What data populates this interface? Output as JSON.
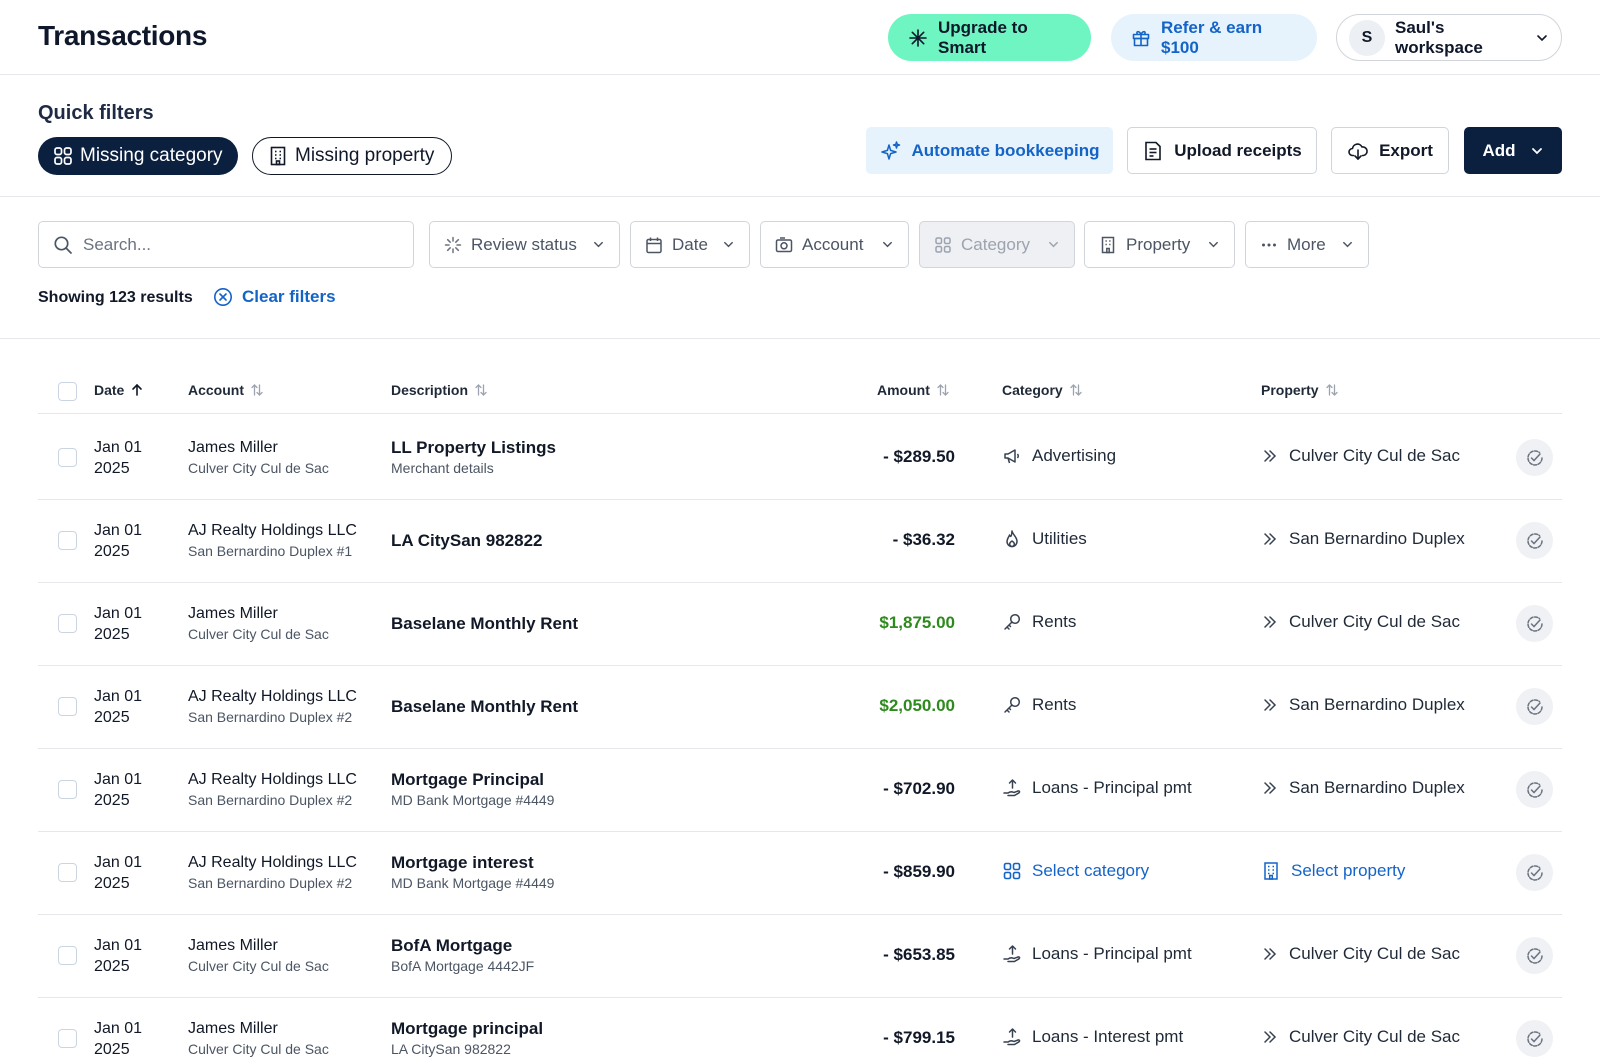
{
  "header": {
    "title": "Transactions",
    "upgrade_label": "Upgrade to Smart",
    "refer_label": "Refer & earn $100",
    "workspace": {
      "avatar_initial": "S",
      "label": "Saul's workspace"
    }
  },
  "quick_filters": {
    "title": "Quick filters",
    "chips": [
      "Missing category",
      "Missing property"
    ],
    "actions": {
      "automate": "Automate bookkeeping",
      "upload": "Upload receipts",
      "export": "Export",
      "add": "Add"
    }
  },
  "filters": {
    "search_placeholder": "Search...",
    "dropdowns": [
      "Review status",
      "Date",
      "Account",
      "Category",
      "Property",
      "More"
    ],
    "results_text": "Showing 123 results",
    "clear_label": "Clear filters"
  },
  "table": {
    "columns": [
      "Date",
      "Account",
      "Description",
      "Amount",
      "Category",
      "Property"
    ],
    "rows": [
      {
        "date": "Jan 01",
        "year": "2025",
        "account": "James Miller",
        "account_sub": "Culver City Cul de Sac",
        "description": "LL Property Listings",
        "description_sub": "Merchant details",
        "amount": "- $289.50",
        "category": "Advertising",
        "category_icon": "megaphone-icon",
        "property": "Culver City Cul de Sac"
      },
      {
        "date": "Jan 01",
        "year": "2025",
        "account": "AJ Realty Holdings LLC",
        "account_sub": "San Bernardino Duplex #1",
        "description": "LA CitySan 982822",
        "description_sub": "",
        "amount": "- $36.32",
        "category": "Utilities",
        "category_icon": "flame-icon",
        "property": "San Bernardino Duplex"
      },
      {
        "date": "Jan 01",
        "year": "2025",
        "account": "James Miller",
        "account_sub": "Culver City Cul de Sac",
        "description": "Baselane Monthly Rent",
        "description_sub": "",
        "amount": "$1,875.00",
        "category": "Rents",
        "category_icon": "key-icon",
        "property": "Culver City Cul de Sac"
      },
      {
        "date": "Jan 01",
        "year": "2025",
        "account": "AJ Realty Holdings LLC",
        "account_sub": "San Bernardino Duplex #2",
        "description": "Baselane Monthly Rent",
        "description_sub": "",
        "amount": "$2,050.00",
        "category": "Rents",
        "category_icon": "key-icon",
        "property": "San Bernardino Duplex"
      },
      {
        "date": "Jan 01",
        "year": "2025",
        "account": "AJ Realty Holdings LLC",
        "account_sub": "San Bernardino Duplex #2",
        "description": "Mortgage Principal",
        "description_sub": "MD Bank Mortgage #4449",
        "amount": "- $702.90",
        "category": "Loans - Principal pmt",
        "category_icon": "loan-icon",
        "property": "San Bernardino Duplex"
      },
      {
        "date": "Jan 01",
        "year": "2025",
        "account": "AJ Realty Holdings LLC",
        "account_sub": "San Bernardino Duplex #2",
        "description": "Mortgage interest",
        "description_sub": "MD Bank Mortgage #4449",
        "amount": "- $859.90",
        "category": "Select category",
        "category_icon": "grid-icon",
        "property": "Select property"
      },
      {
        "date": "Jan 01",
        "year": "2025",
        "account": "James Miller",
        "account_sub": "Culver City Cul de Sac",
        "description": "BofA Mortgage",
        "description_sub": "BofA Mortgage 4442JF",
        "amount": "- $653.85",
        "category": "Loans - Principal pmt",
        "category_icon": "loan-icon",
        "property": "Culver City Cul de Sac"
      },
      {
        "date": "Jan 01",
        "year": "2025",
        "account": "James Miller",
        "account_sub": "Culver City Cul de Sac",
        "description": "Mortgage principal",
        "description_sub": "LA CitySan 982822",
        "amount": "- $799.15",
        "category": "Loans - Interest pmt",
        "category_icon": "loan-icon",
        "property": "Culver City Cul de Sac"
      }
    ]
  },
  "colors": {
    "brand_navy": "#0b1f3f",
    "accent_blue": "#1464c8",
    "upgrade_green": "#6ef5c1",
    "positive_amount": "#2e8a1e"
  }
}
